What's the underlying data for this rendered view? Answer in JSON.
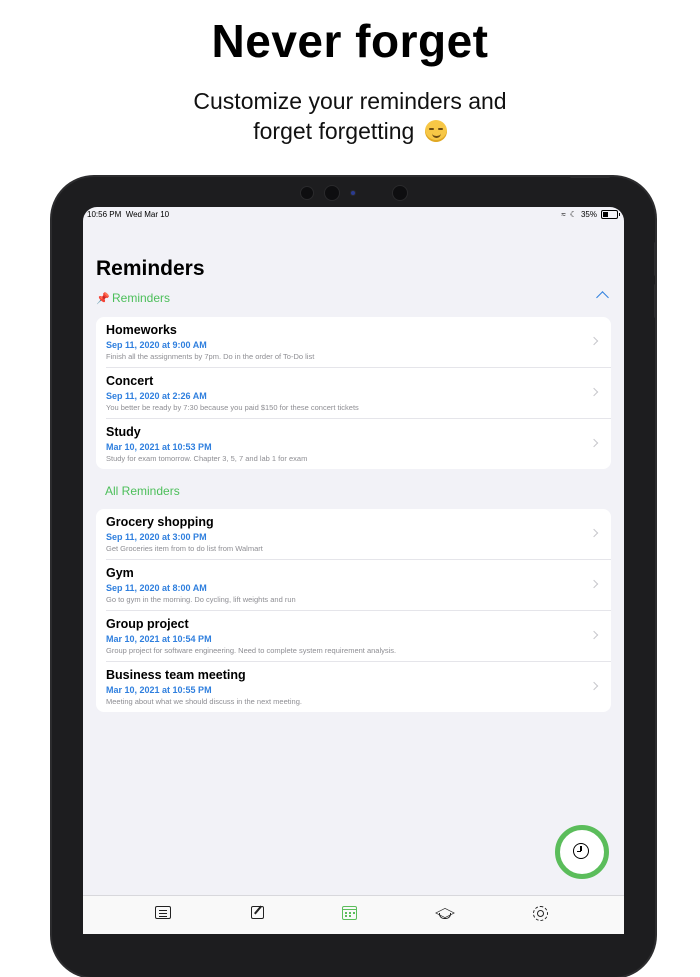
{
  "hero": {
    "title": "Never forget",
    "subtitle_line1": "Customize your reminders and",
    "subtitle_line2": "forget forgetting"
  },
  "status_bar": {
    "time": "10:56 PM",
    "date": "Wed Mar 10",
    "battery": "35%"
  },
  "page_title": "Reminders",
  "pinned_section": {
    "label": "Reminders",
    "items": [
      {
        "title": "Homeworks",
        "date": "Sep 11, 2020 at 9:00 AM",
        "note": "Finish all the assignments by 7pm. Do in the order of To-Do list"
      },
      {
        "title": "Concert",
        "date": "Sep 11, 2020 at 2:26 AM",
        "note": "You better be ready by 7:30 because you paid $150 for these concert tickets"
      },
      {
        "title": "Study",
        "date": "Mar 10, 2021 at 10:53 PM",
        "note": "Study for exam tomorrow. Chapter 3, 5, 7 and lab 1 for exam"
      }
    ]
  },
  "all_section": {
    "label": "All Reminders",
    "items": [
      {
        "title": "Grocery shopping",
        "date": "Sep 11, 2020 at 3:00 PM",
        "note": "Get Groceries item from to do list from Walmart"
      },
      {
        "title": "Gym",
        "date": "Sep 11, 2020 at 8:00 AM",
        "note": "Go to gym in the morning. Do cycling, lift weights and run"
      },
      {
        "title": "Group project",
        "date": "Mar 10, 2021 at 10:54 PM",
        "note": "Group project for software engineering. Need to complete system requirement analysis."
      },
      {
        "title": "Business team meeting",
        "date": "Mar 10, 2021 at 10:55 PM",
        "note": "Meeting about what we should discuss in the next meeting."
      }
    ]
  },
  "tabs": [
    {
      "icon": "list-icon"
    },
    {
      "icon": "compose-icon"
    },
    {
      "icon": "calendar-icon",
      "active": true
    },
    {
      "icon": "graduation-cap-icon"
    },
    {
      "icon": "gear-icon"
    }
  ],
  "colors": {
    "accent_green": "#5bbd5b",
    "date_blue": "#2f7fde",
    "screen_bg": "#f2f2f7"
  }
}
